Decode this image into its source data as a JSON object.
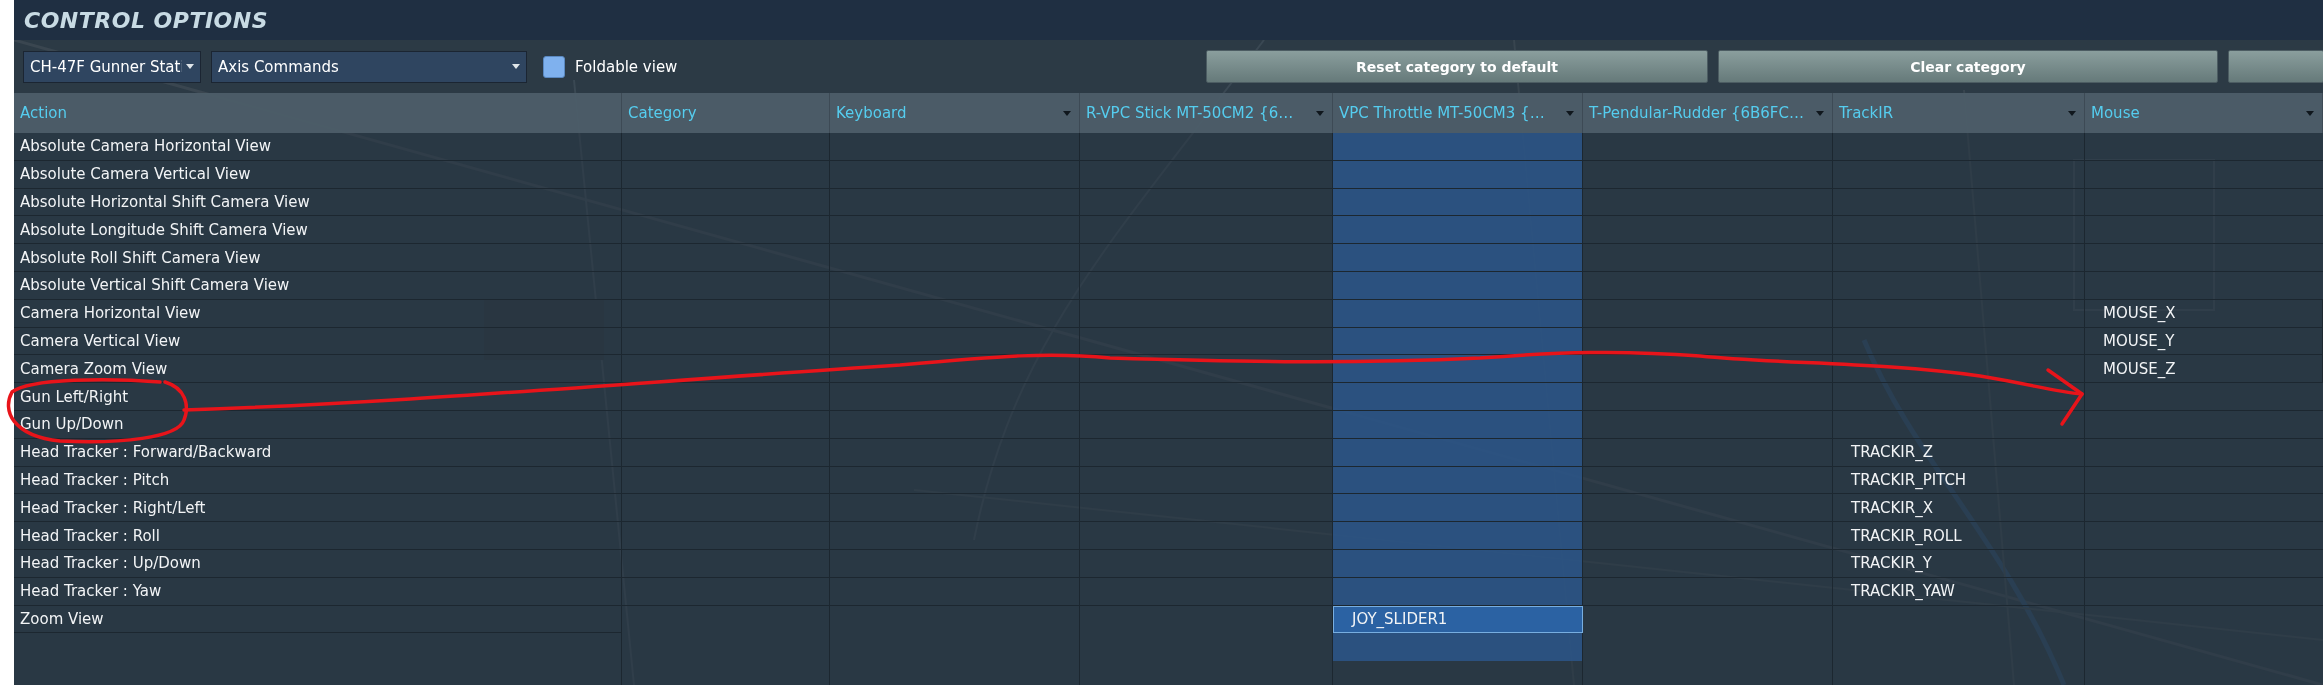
{
  "window": {
    "title": "CONTROL OPTIONS"
  },
  "toolbar": {
    "aircraft_dropdown": {
      "value": "CH-47F Gunner Stati"
    },
    "category_dropdown": {
      "value": "Axis Commands"
    },
    "foldable_view": {
      "label": "Foldable view",
      "checked": false
    },
    "buttons": [
      {
        "label": "Reset category to default"
      },
      {
        "label": "Clear category"
      }
    ]
  },
  "table": {
    "columns": [
      {
        "label": "Action",
        "has_menu": false,
        "selected": false
      },
      {
        "label": "Category",
        "has_menu": false,
        "selected": false
      },
      {
        "label": "Keyboard",
        "has_menu": true,
        "selected": false
      },
      {
        "label": "R-VPC Stick MT-50CM2 {6…",
        "has_menu": true,
        "selected": false
      },
      {
        "label": "VPC Throttle MT-50CM3 {…",
        "has_menu": true,
        "selected": true
      },
      {
        "label": "T-Pendular-Rudder {6B6FC…",
        "has_menu": true,
        "selected": false
      },
      {
        "label": "TrackIR",
        "has_menu": true,
        "selected": false
      },
      {
        "label": "Mouse",
        "has_menu": true,
        "selected": false
      }
    ],
    "rows": [
      {
        "action": "Absolute Camera Horizontal View",
        "selected": false
      },
      {
        "action": "Absolute Camera Vertical View",
        "selected": false
      },
      {
        "action": "Absolute Horizontal Shift Camera View",
        "selected": false
      },
      {
        "action": "Absolute Longitude Shift Camera View",
        "selected": false
      },
      {
        "action": "Absolute Roll Shift Camera View",
        "selected": false
      },
      {
        "action": "Absolute Vertical Shift Camera View",
        "selected": false
      },
      {
        "action": "Camera Horizontal View",
        "mouse": "MOUSE_X",
        "selected": false
      },
      {
        "action": "Camera Vertical View",
        "mouse": "MOUSE_Y",
        "selected": false
      },
      {
        "action": "Camera Zoom View",
        "mouse": "MOUSE_Z",
        "selected": false
      },
      {
        "action": "Gun Left/Right",
        "selected": false
      },
      {
        "action": "Gun Up/Down",
        "selected": false
      },
      {
        "action": "Head Tracker : Forward/Backward",
        "trackir": "TRACKIR_Z",
        "selected": false
      },
      {
        "action": "Head Tracker : Pitch",
        "trackir": "TRACKIR_PITCH",
        "selected": false
      },
      {
        "action": "Head Tracker : Right/Left",
        "trackir": "TRACKIR_X",
        "selected": false
      },
      {
        "action": "Head Tracker : Roll",
        "trackir": "TRACKIR_ROLL",
        "selected": false
      },
      {
        "action": "Head Tracker : Up/Down",
        "trackir": "TRACKIR_Y",
        "selected": false
      },
      {
        "action": "Head Tracker : Yaw",
        "trackir": "TRACKIR_YAW",
        "selected": false
      },
      {
        "action": "Zoom View",
        "throttle": "JOY_SLIDER1",
        "selected": true
      }
    ]
  },
  "annotation": {
    "kind": "freehand-arrow",
    "color": "#e8141a"
  }
}
